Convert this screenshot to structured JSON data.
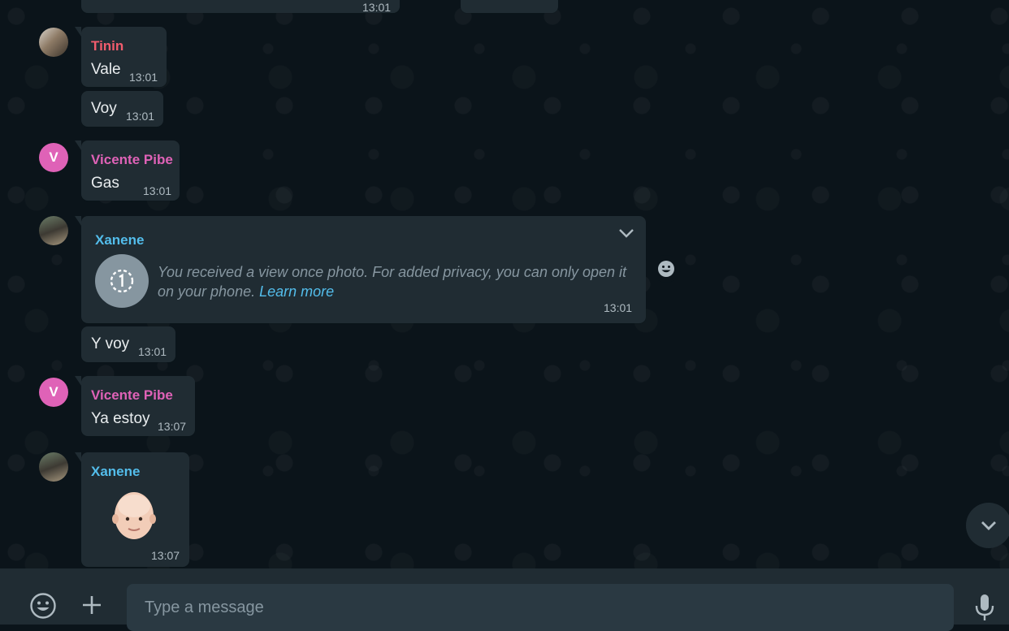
{
  "colors": {
    "tinin": "#f15c6d",
    "vicente": "#df62b7",
    "xanene": "#53bdeb"
  },
  "messages": {
    "top_time": "13:01",
    "m1": {
      "sender": "Tinin",
      "text": "Vale",
      "time": "13:01"
    },
    "m2": {
      "text": "Voy",
      "time": "13:01"
    },
    "m3": {
      "sender": "Vicente Pibe",
      "avatar_letter": "V",
      "text": "Gas",
      "time": "13:01"
    },
    "m4": {
      "sender": "Xanene",
      "text": "You received a view once photo. For added privacy, you can only open it on your phone.",
      "link": "Learn more",
      "time": "13:01",
      "icon": "view-once-icon"
    },
    "m5": {
      "text": "Y voy",
      "time": "13:01"
    },
    "m6": {
      "sender": "Vicente Pibe",
      "avatar_letter": "V",
      "text": "Ya estoy",
      "time": "13:07"
    },
    "m7": {
      "sender": "Xanene",
      "sticker": "bald-face-emoji",
      "time": "13:07"
    }
  },
  "composer": {
    "placeholder": "Type a message",
    "emoji_icon": "emoji-icon",
    "attach_icon": "plus-icon",
    "mic_icon": "mic-icon"
  }
}
